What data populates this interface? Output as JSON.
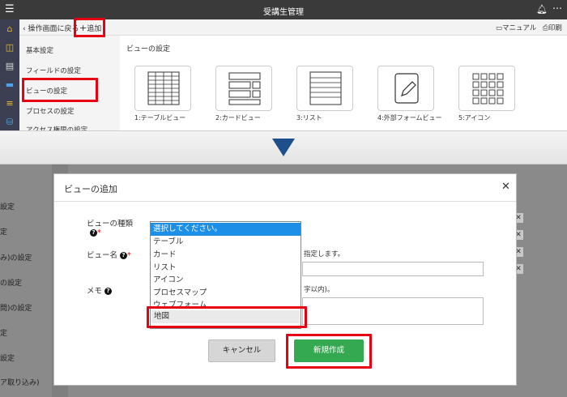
{
  "app": {
    "title": "受講生管理"
  },
  "toolbar": {
    "back_label": "操作画面に戻る",
    "add_label": "追加",
    "manual_label": "マニュアル",
    "print_label": "印刷"
  },
  "menu": {
    "items": [
      "基本設定",
      "フィールドの設定",
      "ビューの設定",
      "プロセスの設定",
      "アクセス権限の設定"
    ],
    "selected": "ビューの設定"
  },
  "content": {
    "title": "ビューの設定",
    "views": [
      {
        "label": "1:テーブルビュー",
        "icon": "table-view-icon"
      },
      {
        "label": "2:カードビュー",
        "icon": "card-view-icon"
      },
      {
        "label": "3:リスト",
        "icon": "list-view-icon"
      },
      {
        "label": "4:外部フォームビュー",
        "icon": "external-form-icon"
      },
      {
        "label": "5:アイコン",
        "icon": "icon-view-icon"
      }
    ]
  },
  "background_items": [
    "設定",
    "定",
    "み)の設定",
    "の設定",
    "問)の設定",
    "定",
    "設定",
    "ア取り込み)"
  ],
  "modal": {
    "title": "ビューの追加",
    "close_icon": "close-icon",
    "view_type_label": "ビューの種類",
    "view_name_label": "ビュー名",
    "memo_label": "メモ",
    "view_name_hint": "指定します。",
    "memo_hint": "字以内)。",
    "dropdown": {
      "options": [
        "選択してください。",
        "テーブル",
        "カード",
        "リスト",
        "アイコン",
        "プロセスマップ",
        "ウェブフォーム",
        "地図"
      ],
      "highlighted_index": 0,
      "callout_index": 7
    },
    "cancel_label": "キャンセル",
    "create_label": "新規作成"
  },
  "colors": {
    "highlight": "#e60012",
    "primary_button": "#35a852",
    "selected_option": "#1e8fe6",
    "titlebar": "#3a3a3a"
  }
}
